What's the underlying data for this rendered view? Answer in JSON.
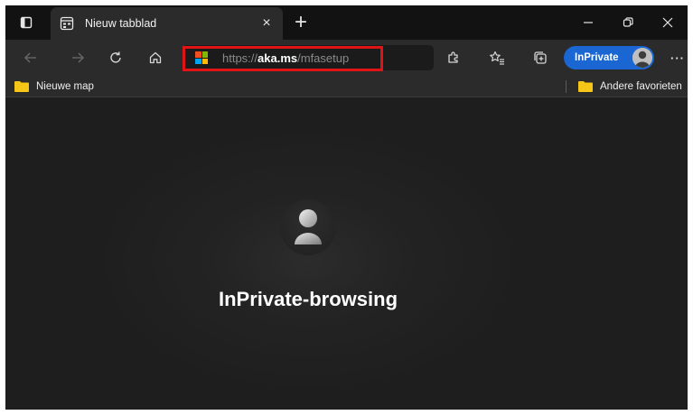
{
  "window": {
    "tab": {
      "title": "Nieuw tabblad",
      "favicon": "new-tab-page-icon",
      "close_label": "×"
    },
    "new_tab_label": "+",
    "controls": [
      "minimize-icon",
      "restore-icon",
      "close-icon"
    ]
  },
  "toolbar": {
    "icons": [
      "back-icon",
      "forward-icon",
      "refresh-icon",
      "home-icon",
      "extensions-icon",
      "favorites-icon",
      "collections-icon",
      "more-icon"
    ],
    "address": {
      "scheme": "https://",
      "host": "aka.ms",
      "path": "/mfasetup"
    },
    "inprivate_label": "InPrivate",
    "more_label": "···"
  },
  "bookmarks": {
    "left_folder": "Nieuwe map",
    "right_folder": "Andere favorieten"
  },
  "content": {
    "title": "InPrivate-browsing",
    "icon": "inprivate-user-icon"
  },
  "colors": {
    "highlight": "#e01414",
    "inprivate_pill": "#1a66d2",
    "folder": "#f5c518",
    "background": "#1f1f1f"
  }
}
